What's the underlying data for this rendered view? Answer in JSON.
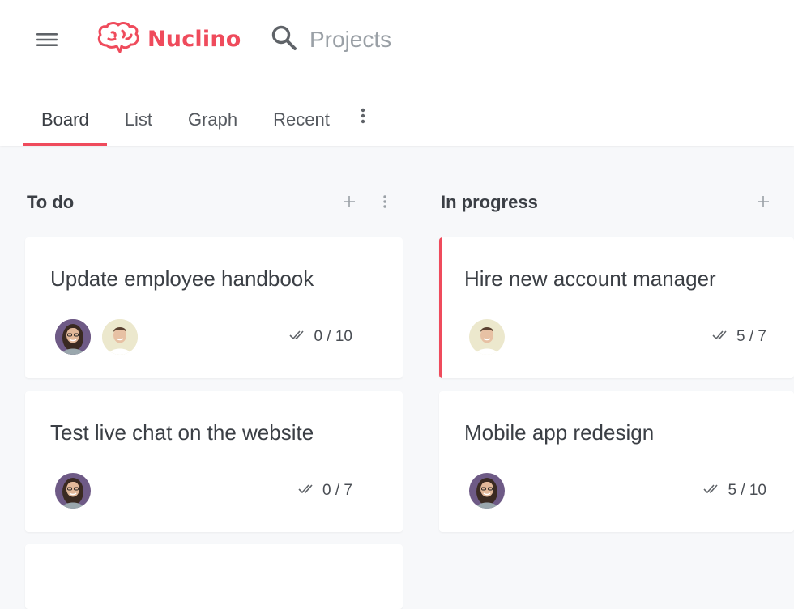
{
  "app": {
    "name": "Nuclino",
    "brand_color": "#ef4b5c"
  },
  "header": {
    "menu_icon": "hamburger-menu-icon",
    "logo_icon": "brain-icon",
    "search_icon": "search-icon",
    "workspace": "Projects"
  },
  "tabs": [
    {
      "label": "Board",
      "active": true
    },
    {
      "label": "List",
      "active": false
    },
    {
      "label": "Graph",
      "active": false
    },
    {
      "label": "Recent",
      "active": false
    }
  ],
  "columns": [
    {
      "title": "To do",
      "cards": [
        {
          "title": "Update employee handbook",
          "assignees": [
            "woman-avatar",
            "man-avatar"
          ],
          "progress": "0 / 10"
        },
        {
          "title": "Test live chat on the website",
          "assignees": [
            "woman-avatar"
          ],
          "progress": "0 / 7"
        },
        {
          "title": "",
          "assignees": [],
          "progress": ""
        }
      ]
    },
    {
      "title": "In progress",
      "cards": [
        {
          "title": "Hire new account manager",
          "assignees": [
            "man-avatar"
          ],
          "progress": "5 / 7",
          "highlighted": true
        },
        {
          "title": "Mobile app redesign",
          "assignees": [
            "woman-avatar"
          ],
          "progress": "5 / 10"
        }
      ]
    }
  ]
}
